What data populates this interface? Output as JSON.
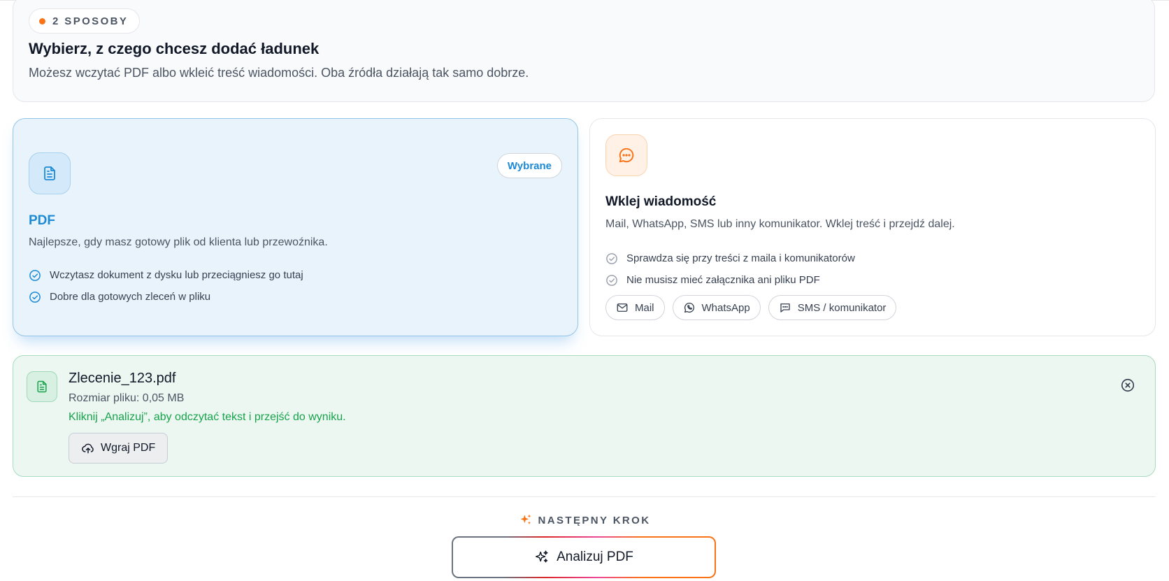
{
  "intro": {
    "pill_label": "2 SPOSOBY",
    "title": "Wybierz, z czego chcesz dodać ładunek",
    "subtitle": "Możesz wczytać PDF albo wkleić treść wiadomości. Oba źródła działają tak samo dobrze."
  },
  "options": {
    "pdf": {
      "icon": "document-icon",
      "badge": "Wybrane",
      "title": "PDF",
      "description": "Najlepsze, gdy masz gotowy plik od klienta lub przewoźnika.",
      "checks": [
        "Wczytasz dokument z dysku lub przeciągniesz go tutaj",
        "Dobre dla gotowych zleceń w pliku"
      ]
    },
    "message": {
      "icon": "chat-bubble-icon",
      "title": "Wklej wiadomość",
      "description": "Mail, WhatsApp, SMS lub inny komunikator. Wklej treść i przejdź dalej.",
      "checks": [
        "Sprawdza się przy treści z maila i komunikatorów",
        "Nie musisz mieć załącznika ani pliku PDF"
      ],
      "chips": [
        {
          "label": "Mail",
          "icon": "mail-icon"
        },
        {
          "label": "WhatsApp",
          "icon": "whatsapp-icon"
        },
        {
          "label": "SMS / komunikator",
          "icon": "message-icon"
        }
      ]
    }
  },
  "file": {
    "name": "Zlecenie_123.pdf",
    "size": "Rozmiar pliku: 0,05 MB",
    "hint": "Kliknij „Analizuj”, aby odczytać tekst i przejść do wyniku.",
    "upload_label": "Wgraj PDF"
  },
  "next_step": {
    "label": "NASTĘPNY KROK",
    "button_label": "Analizuj PDF"
  },
  "colors": {
    "accent_blue": "#1d8ad6",
    "accent_orange": "#f97316",
    "success_green": "#16a34a"
  }
}
